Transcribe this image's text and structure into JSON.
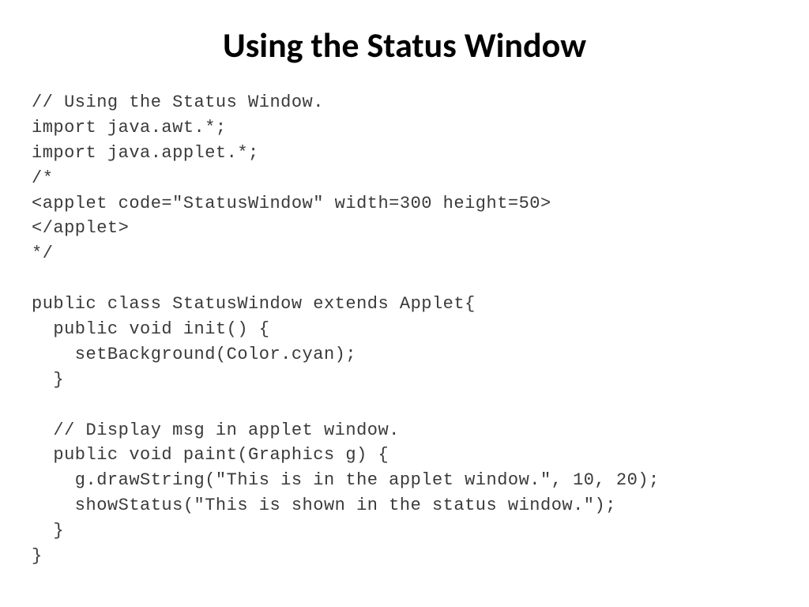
{
  "title": "Using the Status Window",
  "code_lines": [
    "// Using the Status Window.",
    "import java.awt.*;",
    "import java.applet.*;",
    "/*",
    "<applet code=\"StatusWindow\" width=300 height=50>",
    "</applet>",
    "*/",
    "",
    "public class StatusWindow extends Applet{",
    "  public void init() {",
    "    setBackground(Color.cyan);",
    "  }",
    "",
    "  // Display msg in applet window.",
    "  public void paint(Graphics g) {",
    "    g.drawString(\"This is in the applet window.\", 10, 20);",
    "    showStatus(\"This is shown in the status window.\");",
    "  }",
    "}"
  ]
}
